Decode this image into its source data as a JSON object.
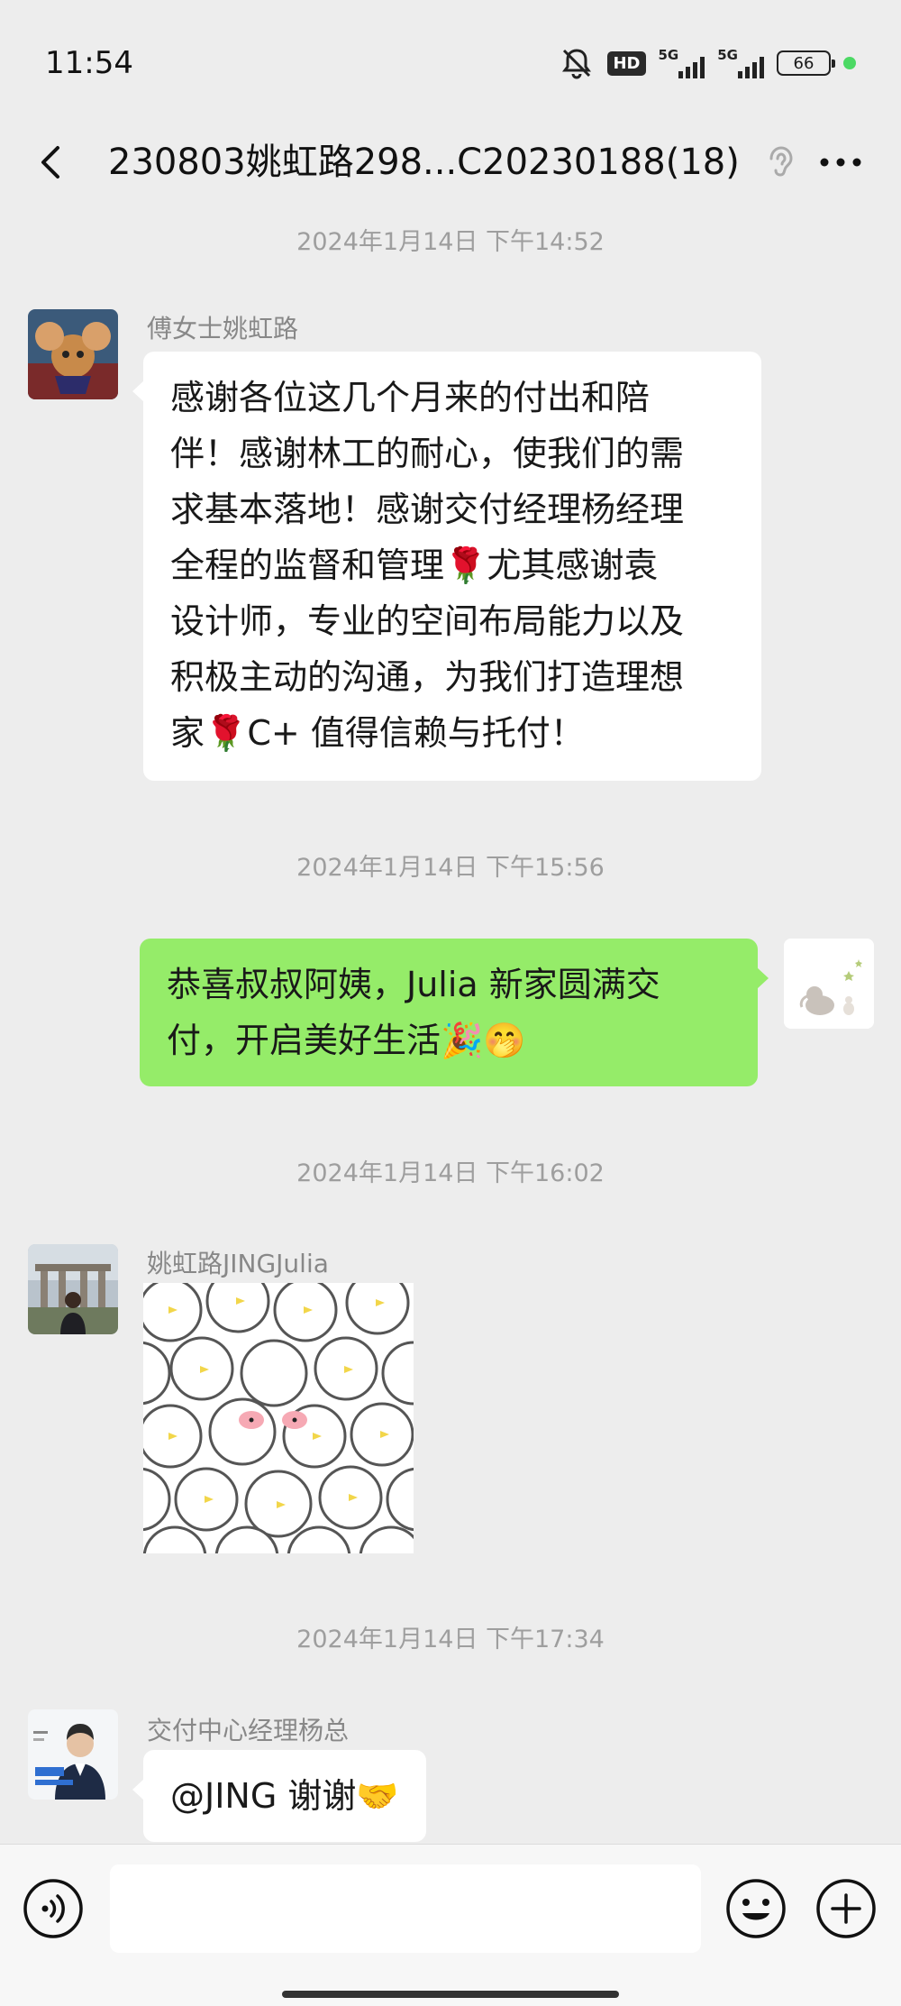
{
  "status_bar": {
    "time": "11:54",
    "hd_label": "HD",
    "network_1": "5G",
    "network_2": "5G",
    "battery": "66"
  },
  "header": {
    "title": "230803姚虹路298...C20230188(18)"
  },
  "messages": [
    {
      "timestamp": "2024年1月14日 下午14:52",
      "sender": "傅女士姚虹路",
      "lines": [
        "感谢各位这几个月来的付出和陪",
        "伴！感谢林工的耐心，使我们的需",
        "求基本落地！感谢交付经理杨经理",
        "全程的监督和管理🌹尤其感谢袁",
        "设计师，专业的空间布局能力以及",
        "积极主动的沟通，为我们打造理想",
        "家🌹C+ 值得信赖与托付！"
      ]
    },
    {
      "timestamp": "2024年1月14日 下午15:56",
      "lines": [
        "恭喜叔叔阿姨，Julia 新家圆满交",
        "付，开启美好生活🎉🤭"
      ]
    },
    {
      "timestamp": "2024年1月14日 下午16:02",
      "sender": "姚虹路JINGJulia"
    },
    {
      "timestamp": "2024年1月14日 下午17:34",
      "sender": "交付中心经理杨总",
      "text": "@JING  谢谢🤝"
    }
  ],
  "input": {
    "placeholder": ""
  },
  "colors": {
    "background": "#ededed",
    "self_bubble": "#95ec69",
    "other_bubble": "#ffffff"
  },
  "icons": [
    "back-icon",
    "ear-icon",
    "more-icon",
    "voice-icon",
    "emoji-icon",
    "plus-icon"
  ]
}
